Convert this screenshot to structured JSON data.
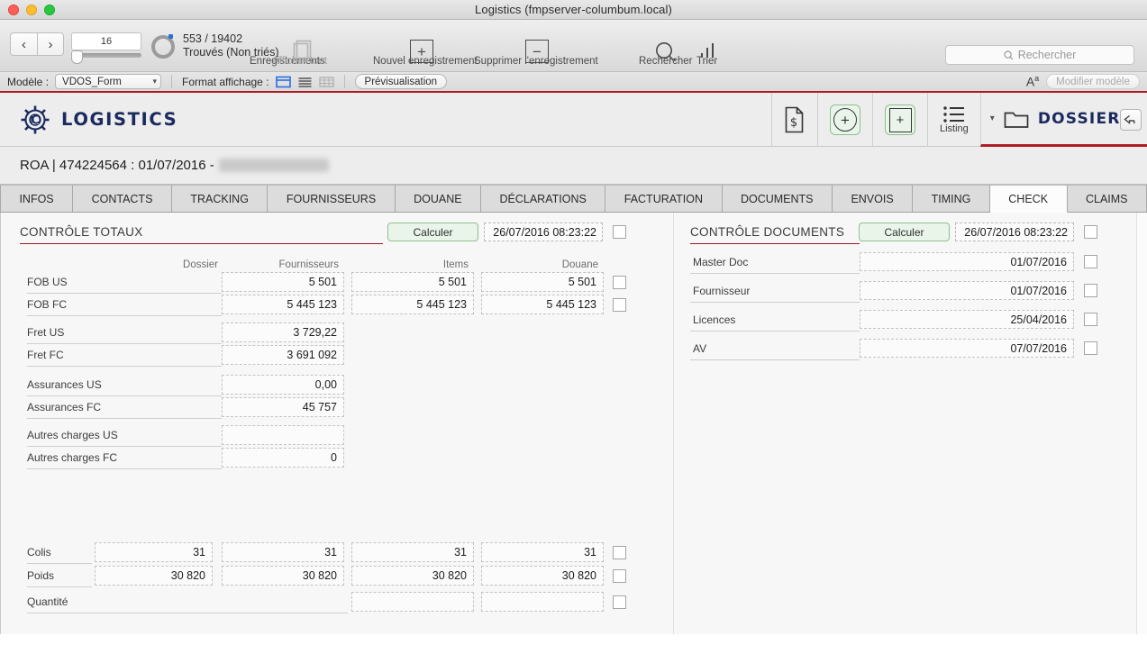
{
  "window": {
    "title": "Logistics (fmpserver-columbum.local)"
  },
  "toolbar": {
    "prev_label": "‹",
    "next_label": "›",
    "record_number": "16",
    "found_count": "553 / 19402",
    "found_state": "Trouvés (Non triés)",
    "records_caption": "Enregistrements",
    "show_all_caption": "Afficher tout",
    "new_record_caption": "Nouvel enregistrement",
    "delete_record_caption": "Supprimer l'enregistrement",
    "find_caption": "Rechercher",
    "sort_caption": "Trier",
    "search_placeholder": "Rechercher"
  },
  "layoutbar": {
    "model_label": "Modèle :",
    "model_value": "VDOS_Form",
    "view_label": "Format affichage :",
    "preview_label": "Prévisualisation",
    "text_icon": "A",
    "edit_layout_label": "Modifier modèle"
  },
  "appheader": {
    "brand": "LOGISTICS",
    "listing_label": "Listing",
    "dossiers_label": "DOSSIERS"
  },
  "record": {
    "prefix": "ROA | 474224564 : 01/07/2016 -"
  },
  "tabs": [
    {
      "label": "INFOS",
      "active": false
    },
    {
      "label": "CONTACTS",
      "active": false
    },
    {
      "label": "TRACKING",
      "active": false
    },
    {
      "label": "FOURNISSEURS",
      "active": false
    },
    {
      "label": "DOUANE",
      "active": false
    },
    {
      "label": "DÉCLARATIONS",
      "active": false
    },
    {
      "label": "FACTURATION",
      "active": false
    },
    {
      "label": "DOCUMENTS",
      "active": false
    },
    {
      "label": "ENVOIS",
      "active": false
    },
    {
      "label": "TIMING",
      "active": false
    },
    {
      "label": "CHECK",
      "active": true
    },
    {
      "label": "CLAIMS",
      "active": false
    }
  ],
  "totals": {
    "title": "CONTRÔLE TOTAUX",
    "calc_label": "Calculer",
    "timestamp": "26/07/2016 08:23:22",
    "columns": [
      "Dossier",
      "Fournisseurs",
      "Items",
      "Douane"
    ],
    "rows": [
      {
        "label": "FOB US",
        "dossier": "",
        "fournisseurs": "5 501",
        "items": "5 501",
        "douane": "5 501",
        "checkbox": true
      },
      {
        "label": "FOB FC",
        "dossier": "",
        "fournisseurs": "5 445 123",
        "items": "5 445 123",
        "douane": "5 445 123",
        "checkbox": true
      },
      {
        "label": "Fret US",
        "dossier": "",
        "fournisseurs": "3 729,22",
        "items": "",
        "douane": "",
        "checkbox": false
      },
      {
        "label": "Fret FC",
        "dossier": "",
        "fournisseurs": "3 691 092",
        "items": "",
        "douane": "",
        "checkbox": false
      },
      {
        "label": "Assurances US",
        "dossier": "",
        "fournisseurs": "0,00",
        "items": "",
        "douane": "",
        "checkbox": false
      },
      {
        "label": "Assurances FC",
        "dossier": "",
        "fournisseurs": "45 757",
        "items": "",
        "douane": "",
        "checkbox": false
      },
      {
        "label": "Autres charges US",
        "dossier": "",
        "fournisseurs": "",
        "items": "",
        "douane": "",
        "checkbox": false
      },
      {
        "label": "Autres charges FC",
        "dossier": "",
        "fournisseurs": "0",
        "items": "",
        "douane": "",
        "checkbox": false
      }
    ],
    "bottom_rows": [
      {
        "label": "Colis",
        "dossier": "31",
        "fournisseurs": "31",
        "items": "31",
        "douane": "31",
        "checkbox": true
      },
      {
        "label": "Poids",
        "dossier": "30 820",
        "fournisseurs": "30 820",
        "items": "30 820",
        "douane": "30 820",
        "checkbox": true
      },
      {
        "label": "Quantité",
        "dossier": "",
        "fournisseurs": "",
        "items": "",
        "douane": "",
        "checkbox": true
      }
    ]
  },
  "documents": {
    "title": "CONTRÔLE DOCUMENTS",
    "calc_label": "Calculer",
    "timestamp": "26/07/2016 08:23:22",
    "rows": [
      {
        "label": "Master Doc",
        "value": "01/07/2016"
      },
      {
        "label": "Fournisseur",
        "value": "01/07/2016"
      },
      {
        "label": "Licences",
        "value": "25/04/2016"
      },
      {
        "label": "AV",
        "value": "07/07/2016"
      }
    ]
  },
  "colors": {
    "brand_navy": "#1b2a5e",
    "accent_red": "#b01c26",
    "calc_green_bg": "#e9f5e9",
    "calc_green_border": "#8fbf8f"
  }
}
